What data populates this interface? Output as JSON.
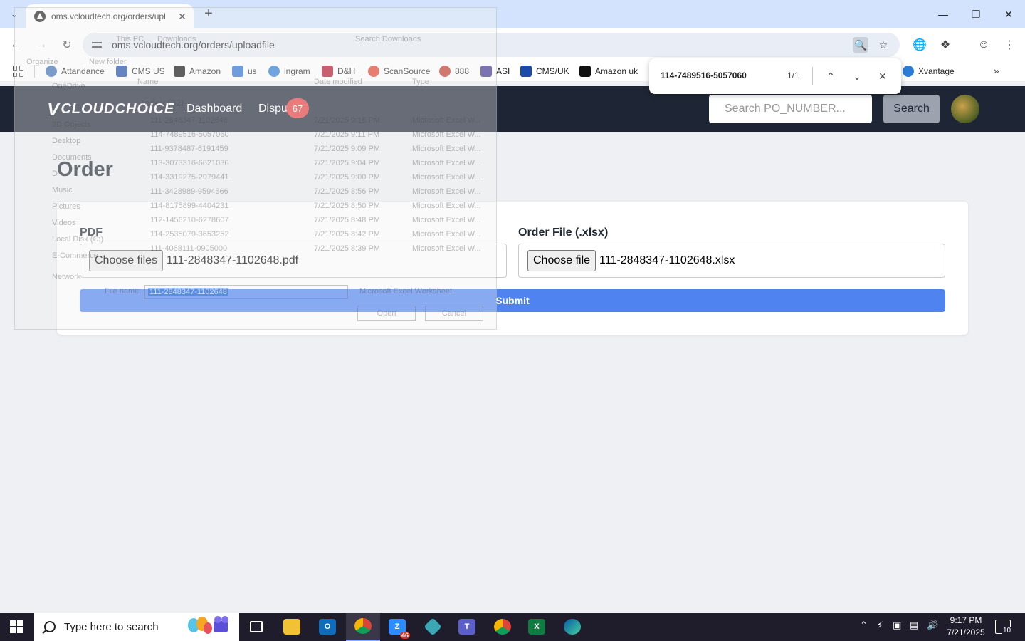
{
  "browser": {
    "tab_title": "oms.vcloudtech.org/orders/upl",
    "url": "oms.vcloudtech.org/orders/uploadfile",
    "bookmarks": [
      "Attandance",
      "CMS US",
      "Amazon",
      "us",
      "ingram",
      "D&H",
      "ScanSource",
      "888",
      "ASI",
      "CMS/UK",
      "Amazon uk",
      "Xvantage"
    ],
    "find": {
      "query": "114-7489516-5057060",
      "count": "1/1"
    }
  },
  "app": {
    "logo_text": "CLOUDCHOICE",
    "nav": {
      "dashboard": "Dashboard",
      "disputes": "Dispu",
      "disputes_badge": "67"
    },
    "search": {
      "placeholder": "Search PO_NUMBER...",
      "button": "Search"
    },
    "page_title": "Order",
    "form": {
      "pdf_label": "PDF",
      "pdf_button": "Choose files",
      "pdf_file": "111-2848347-1102648.pdf",
      "xlsx_label": "Order File (.xlsx)",
      "xlsx_button": "Choose file",
      "xlsx_file": "111-2848347-1102648.xlsx",
      "submit": "Submit"
    }
  },
  "ghost_dialog": {
    "path": [
      "This PC",
      "Downloads"
    ],
    "search_placeholder": "Search Downloads",
    "toolbar": [
      "Organize",
      "New folder"
    ],
    "columns": [
      "Name",
      "Date modified",
      "Type"
    ],
    "group": "Today (32)",
    "sidebar": [
      "OneDrive",
      "3D Objects",
      "Desktop",
      "Documents",
      "D",
      "Music",
      "Pictures",
      "Videos",
      "Local Disk (C:)",
      "E-Commerce",
      "Network"
    ],
    "files": [
      {
        "name": "111-2848347-1102648",
        "date": "7/21/2025 9:16 PM",
        "type": "Microsoft Excel W..."
      },
      {
        "name": "114-7489516-5057060",
        "date": "7/21/2025 9:11 PM",
        "type": "Microsoft Excel W..."
      },
      {
        "name": "111-9378487-6191459",
        "date": "7/21/2025 9:09 PM",
        "type": "Microsoft Excel W..."
      },
      {
        "name": "113-3073316-6621036",
        "date": "7/21/2025 9:04 PM",
        "type": "Microsoft Excel W..."
      },
      {
        "name": "114-3319275-2979441",
        "date": "7/21/2025 9:00 PM",
        "type": "Microsoft Excel W..."
      },
      {
        "name": "111-3428989-9594666",
        "date": "7/21/2025 8:56 PM",
        "type": "Microsoft Excel W..."
      },
      {
        "name": "114-8175899-4404231",
        "date": "7/21/2025 8:50 PM",
        "type": "Microsoft Excel W..."
      },
      {
        "name": "112-1456210-6278607",
        "date": "7/21/2025 8:48 PM",
        "type": "Microsoft Excel W..."
      },
      {
        "name": "114-2535079-3653252",
        "date": "7/21/2025 8:42 PM",
        "type": "Microsoft Excel W..."
      },
      {
        "name": "111-4068111-0905000",
        "date": "7/21/2025 8:39 PM",
        "type": "Microsoft Excel W..."
      }
    ],
    "file_name_label": "File name:",
    "file_name_value": "111-2848347-1102648",
    "file_type": "Microsoft Excel Worksheet",
    "open": "Open",
    "cancel": "Cancel"
  },
  "taskbar": {
    "search_placeholder": "Type here to search",
    "zoom_badge": "46",
    "time": "9:17 PM",
    "date": "7/21/2025",
    "notifications": "10"
  },
  "colors": {
    "appbar": "#1e2635",
    "submit": "#4f84f0",
    "badge": "#e33e3e",
    "tabstrip": "#d3e3fd"
  }
}
